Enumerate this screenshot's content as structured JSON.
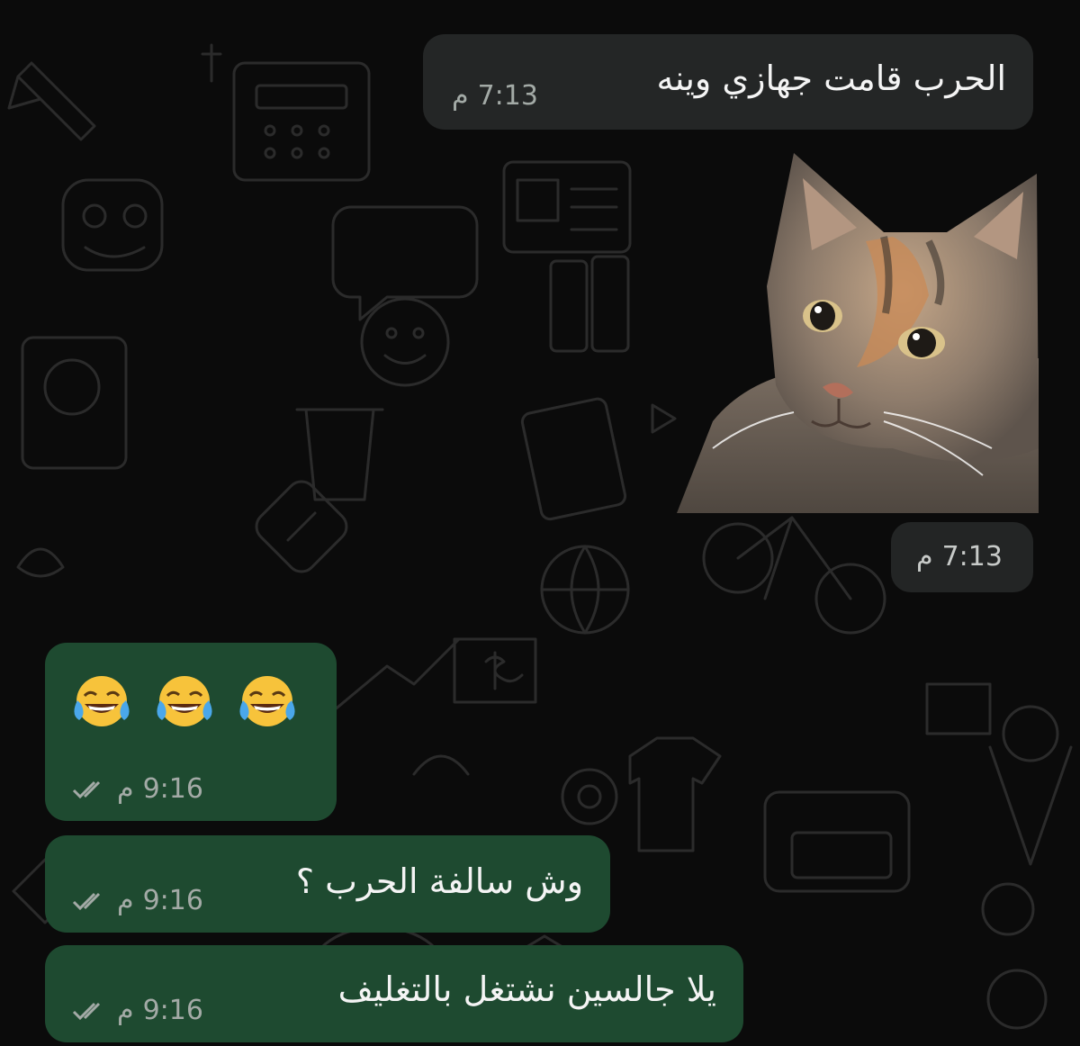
{
  "messages": [
    {
      "direction": "incoming",
      "text": "الحرب قامت جهازي وينه",
      "time": "7:13",
      "period": "م"
    },
    {
      "direction": "incoming",
      "type": "sticker",
      "sticker": "cat-face-sticker",
      "time": "7:13",
      "period": "م"
    },
    {
      "direction": "outgoing",
      "type": "emoji",
      "emojis": [
        "face-with-tears-of-joy",
        "face-with-tears-of-joy",
        "face-with-tears-of-joy"
      ],
      "time": "9:16",
      "period": "م",
      "status": "double-check-read"
    },
    {
      "direction": "outgoing",
      "text": "وش سالفة الحرب ؟",
      "time": "9:16",
      "period": "م",
      "status": "double-check-read"
    },
    {
      "direction": "outgoing",
      "text": "يلا جالسين نشتغل بالتغليف",
      "time": "9:16",
      "period": "م",
      "status": "double-check-read"
    }
  ],
  "colors": {
    "background": "#0b0b0b",
    "incoming_bubble": "#242626",
    "outgoing_bubble": "#1e4a30",
    "text": "#f4f4f4",
    "meta_text": "#a3aaa6"
  }
}
